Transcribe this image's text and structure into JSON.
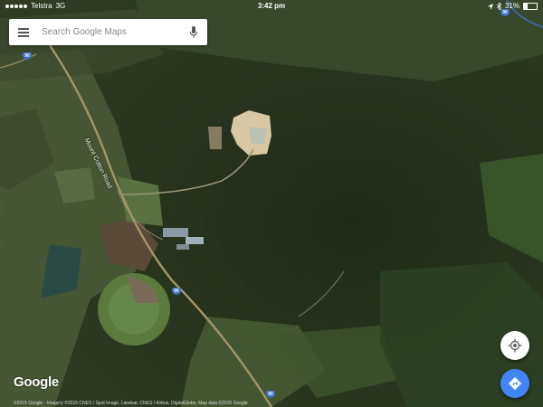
{
  "status_bar": {
    "carrier": "Telstra",
    "network": "3G",
    "time": "3:42 pm",
    "battery": "31%",
    "battery_level": 0.31
  },
  "search": {
    "placeholder": "Search Google Maps"
  },
  "map": {
    "road_label": "Mount Cotton Road",
    "route_shields": [
      "90",
      "90",
      "90",
      "90"
    ],
    "logo": "Google",
    "attribution": "©2015 Google - Imagery ©2015 CNES / Spot Image, Landsat, CNES / Airbus, DigitalGlobe, Map data ©2015 Google"
  },
  "colors": {
    "brand_blue": "#4285f4",
    "shield_blue": "#3f6fc4",
    "road": "#a59567"
  },
  "icons": {
    "menu": "menu-icon",
    "mic": "mic-icon",
    "location": "my-location-icon",
    "directions": "directions-icon"
  }
}
